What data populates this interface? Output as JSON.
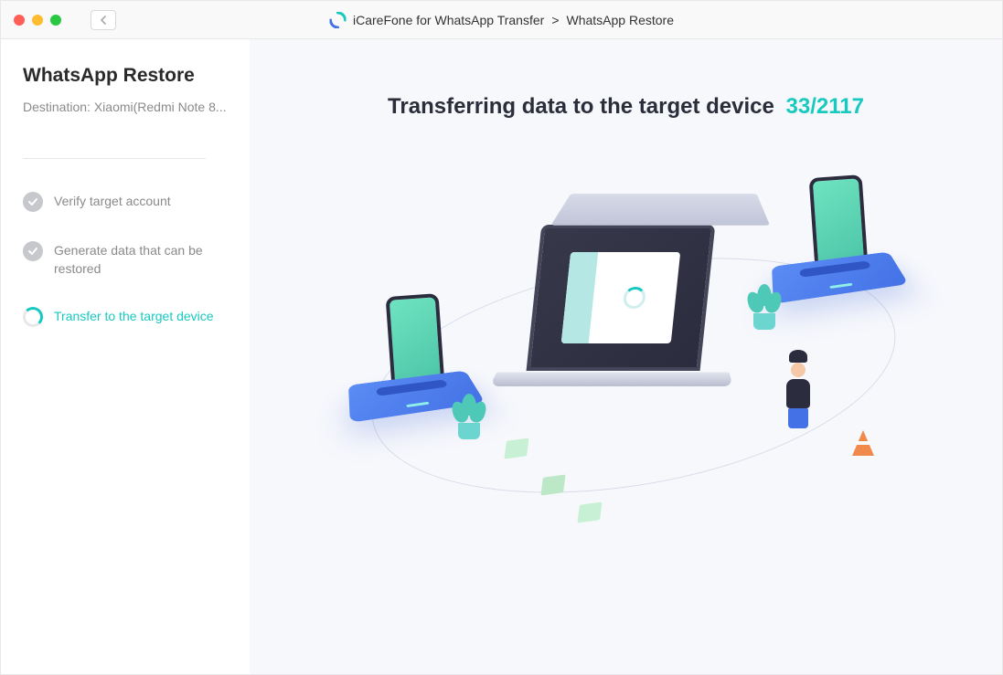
{
  "titlebar": {
    "app_name": "iCareFone for WhatsApp Transfer",
    "breadcrumb_sep": ">",
    "page": "WhatsApp Restore"
  },
  "sidebar": {
    "title": "WhatsApp Restore",
    "destination_label": "Destination:",
    "destination_value": "Xiaomi(Redmi Note 8...",
    "steps": [
      {
        "label": "Verify target account",
        "state": "done"
      },
      {
        "label": "Generate data that can be restored",
        "state": "done"
      },
      {
        "label": "Transfer to the target device",
        "state": "active"
      }
    ]
  },
  "main": {
    "heading": "Transferring data to the target device",
    "progress_current": 33,
    "progress_total": 2117
  },
  "colors": {
    "accent": "#18c9c0",
    "primary_blue": "#4472e6"
  }
}
